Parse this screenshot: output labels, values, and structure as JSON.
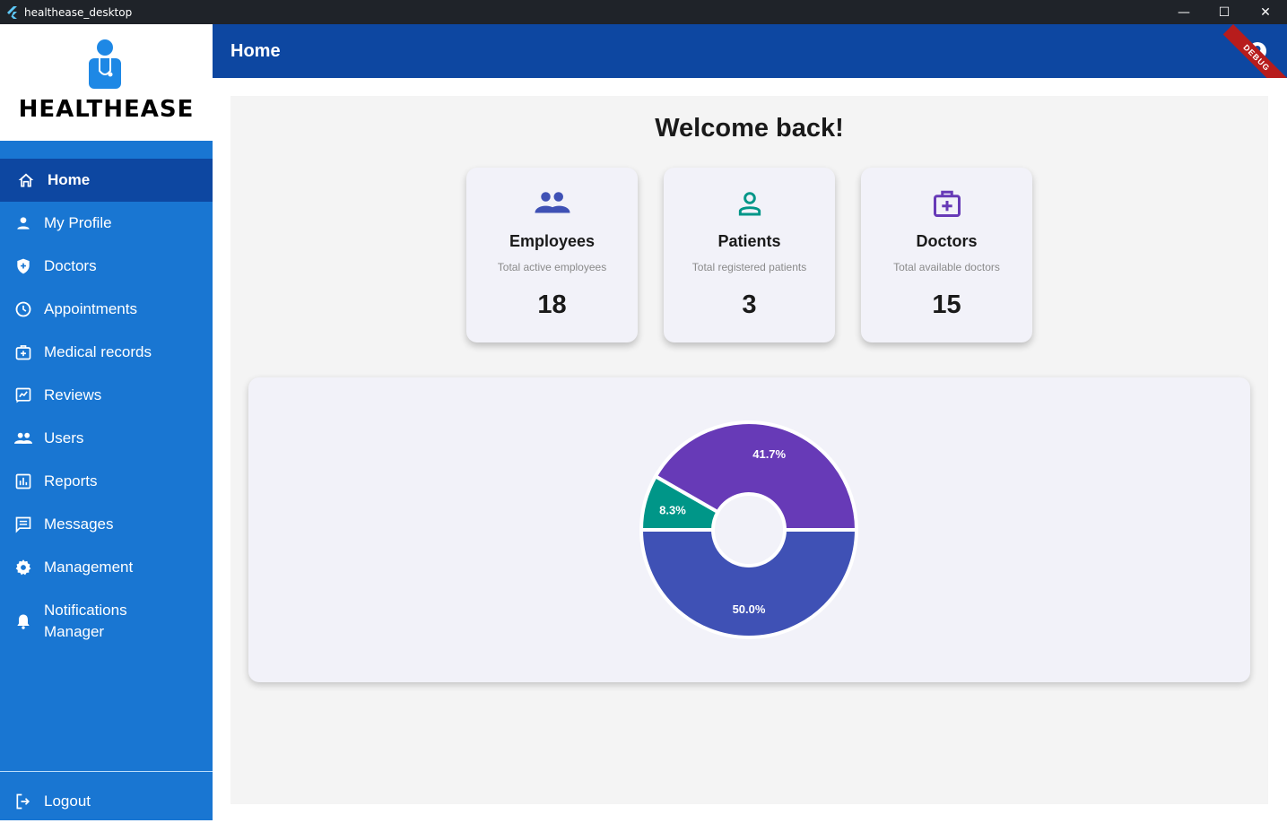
{
  "window": {
    "title": "healthease_desktop",
    "controls": [
      "—",
      "☐",
      "✕"
    ]
  },
  "brand": {
    "logo_text": "HEALTHEASE"
  },
  "sidebar": {
    "items": [
      {
        "label": "Home",
        "icon": "home-icon",
        "active": true
      },
      {
        "label": "My Profile",
        "icon": "person-icon"
      },
      {
        "label": "Doctors",
        "icon": "shield-plus-icon"
      },
      {
        "label": "Appointments",
        "icon": "clock-icon"
      },
      {
        "label": "Medical records",
        "icon": "medical-bag-icon"
      },
      {
        "label": "Reviews",
        "icon": "reviews-icon"
      },
      {
        "label": "Users",
        "icon": "group-icon"
      },
      {
        "label": "Reports",
        "icon": "bar-chart-icon"
      },
      {
        "label": "Messages",
        "icon": "message-icon"
      },
      {
        "label": "Management",
        "icon": "gear-icon"
      },
      {
        "label": "Notifications Manager",
        "icon": "bell-icon"
      }
    ],
    "logout_label": "Logout"
  },
  "header": {
    "title": "Home",
    "debug_label": "DEBUG"
  },
  "main": {
    "welcome": "Welcome back!",
    "cards": [
      {
        "title": "Employees",
        "subtitle": "Total active employees",
        "value": "18",
        "icon": "group-icon",
        "color": "#3f51b5"
      },
      {
        "title": "Patients",
        "subtitle": "Total registered patients",
        "value": "3",
        "icon": "person-outline-icon",
        "color": "#009688"
      },
      {
        "title": "Doctors",
        "subtitle": "Total available doctors",
        "value": "15",
        "icon": "medical-bag-icon",
        "color": "#673ab7"
      }
    ]
  },
  "colors": {
    "sidebar": "#1976d2",
    "sidebar_active": "#0d47a1",
    "header": "#0d47a1",
    "indigo": "#3f51b5",
    "teal": "#009688",
    "purple": "#673ab7"
  },
  "chart_data": {
    "type": "pie",
    "donut": true,
    "title": "",
    "slices": [
      {
        "value": 50.0,
        "label": "50.0%",
        "color": "#3f51b5"
      },
      {
        "value": 8.3,
        "label": "8.3%",
        "color": "#009688"
      },
      {
        "value": 41.7,
        "label": "41.7%",
        "color": "#673ab7"
      }
    ]
  }
}
